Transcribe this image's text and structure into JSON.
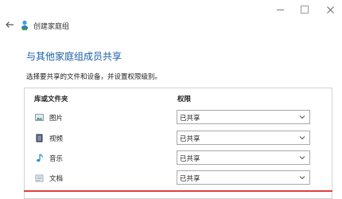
{
  "window": {
    "title": "创建家庭组"
  },
  "page": {
    "heading": "与其他家庭组成员共享",
    "description": "选择要共享的文件和设备，并设置权限级别。"
  },
  "table": {
    "col_library": "库或文件夹",
    "col_permission": "权限",
    "rows": [
      {
        "label": "图片",
        "icon": "pictures-icon",
        "permission": "已共享"
      },
      {
        "label": "视频",
        "icon": "videos-icon",
        "permission": "已共享"
      },
      {
        "label": "音乐",
        "icon": "music-icon",
        "permission": "已共享"
      },
      {
        "label": "文档",
        "icon": "documents-icon",
        "permission": "已共享"
      }
    ]
  },
  "colors": {
    "heading": "#1a5fa6",
    "focus": "#e04040"
  }
}
